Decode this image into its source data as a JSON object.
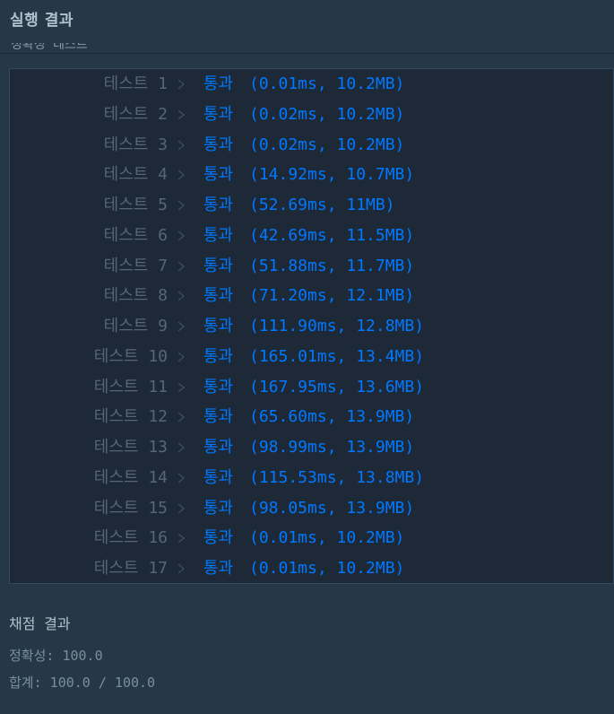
{
  "header": {
    "title": "실행 결과"
  },
  "section": {
    "label": "정확성 테스트"
  },
  "results": [
    {
      "name": "테스트 1",
      "status": "통과",
      "detail": "(0.01ms, 10.2MB)"
    },
    {
      "name": "테스트 2",
      "status": "통과",
      "detail": "(0.02ms, 10.2MB)"
    },
    {
      "name": "테스트 3",
      "status": "통과",
      "detail": "(0.02ms, 10.2MB)"
    },
    {
      "name": "테스트 4",
      "status": "통과",
      "detail": "(14.92ms, 10.7MB)"
    },
    {
      "name": "테스트 5",
      "status": "통과",
      "detail": "(52.69ms, 11MB)"
    },
    {
      "name": "테스트 6",
      "status": "통과",
      "detail": "(42.69ms, 11.5MB)"
    },
    {
      "name": "테스트 7",
      "status": "통과",
      "detail": "(51.88ms, 11.7MB)"
    },
    {
      "name": "테스트 8",
      "status": "통과",
      "detail": "(71.20ms, 12.1MB)"
    },
    {
      "name": "테스트 9",
      "status": "통과",
      "detail": "(111.90ms, 12.8MB)"
    },
    {
      "name": "테스트 10",
      "status": "통과",
      "detail": "(165.01ms, 13.4MB)"
    },
    {
      "name": "테스트 11",
      "status": "통과",
      "detail": "(167.95ms, 13.6MB)"
    },
    {
      "name": "테스트 12",
      "status": "통과",
      "detail": "(65.60ms, 13.9MB)"
    },
    {
      "name": "테스트 13",
      "status": "통과",
      "detail": "(98.99ms, 13.9MB)"
    },
    {
      "name": "테스트 14",
      "status": "통과",
      "detail": "(115.53ms, 13.8MB)"
    },
    {
      "name": "테스트 15",
      "status": "통과",
      "detail": "(98.05ms, 13.9MB)"
    },
    {
      "name": "테스트 16",
      "status": "통과",
      "detail": "(0.01ms, 10.2MB)"
    },
    {
      "name": "테스트 17",
      "status": "통과",
      "detail": "(0.01ms, 10.2MB)"
    }
  ],
  "grading": {
    "title": "채점 결과",
    "accuracy_label": "정확성:",
    "accuracy_value": "100.0",
    "total_label": "합계:",
    "total_value": "100.0 / 100.0"
  },
  "icons": {
    "row_separator": "chevron-right-icon"
  },
  "colors": {
    "pass": "#0078ff",
    "muted": "#53667a",
    "background": "#263747",
    "panel": "#1e2937"
  }
}
